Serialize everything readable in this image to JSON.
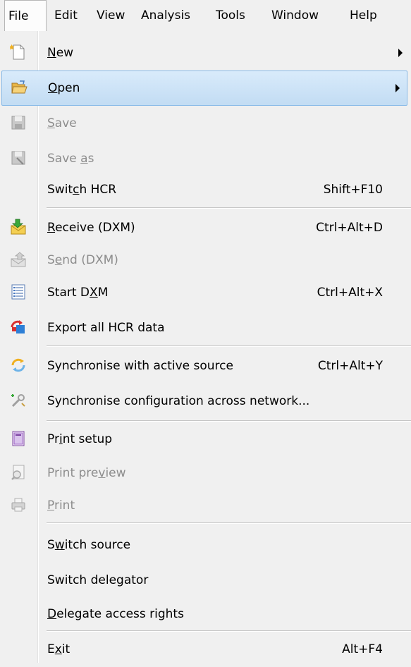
{
  "menubar": {
    "items": [
      "File",
      "Edit",
      "View",
      "Analysis",
      "Tools",
      "Window",
      "Help"
    ],
    "open": "File"
  },
  "menu": {
    "items": [
      {
        "label": "New",
        "mnemonic": "N",
        "has_submenu": true,
        "icon": "new-document-icon",
        "enabled": true
      },
      {
        "label": "Open",
        "mnemonic": "O",
        "has_submenu": true,
        "icon": "open-folder-icon",
        "enabled": true,
        "highlighted": true
      },
      {
        "label": "Save",
        "mnemonic": "S",
        "icon": "save-icon",
        "enabled": false
      },
      {
        "label": "Save as",
        "mnemonic": "a",
        "icon": "save-as-icon",
        "enabled": false
      },
      {
        "label": "Switch HCR",
        "mnemonic": "c",
        "shortcut": "Shift+F10",
        "enabled": true
      },
      {
        "label": "Receive (DXM)",
        "mnemonic": "R",
        "shortcut": "Ctrl+Alt+D",
        "icon": "receive-mail-icon",
        "enabled": true
      },
      {
        "label": "Send (DXM)",
        "mnemonic": "e",
        "icon": "send-mail-icon",
        "enabled": false
      },
      {
        "label": "Start DXM",
        "mnemonic": "X",
        "shortcut": "Ctrl+Alt+X",
        "icon": "list-document-icon",
        "enabled": true
      },
      {
        "label": "Export all HCR data",
        "icon": "export-icon",
        "enabled": true
      },
      {
        "label": "Synchronise with active source",
        "shortcut": "Ctrl+Alt+Y",
        "icon": "sync-icon",
        "enabled": true
      },
      {
        "label": "Synchronise configuration across network...",
        "icon": "network-config-icon",
        "enabled": true
      },
      {
        "label": "Print setup",
        "mnemonic": "i",
        "icon": "print-setup-icon",
        "enabled": true
      },
      {
        "label": "Print preview",
        "mnemonic": "v",
        "icon": "print-preview-icon",
        "enabled": false
      },
      {
        "label": "Print",
        "mnemonic": "P",
        "icon": "printer-icon",
        "enabled": false
      },
      {
        "label": "Switch source",
        "mnemonic": "w",
        "enabled": true
      },
      {
        "label": "Switch delegator",
        "enabled": true
      },
      {
        "label": "Delegate access rights",
        "mnemonic": "D",
        "enabled": true
      },
      {
        "label": "Exit",
        "mnemonic": "x",
        "shortcut": "Alt+F4",
        "enabled": true
      }
    ]
  }
}
